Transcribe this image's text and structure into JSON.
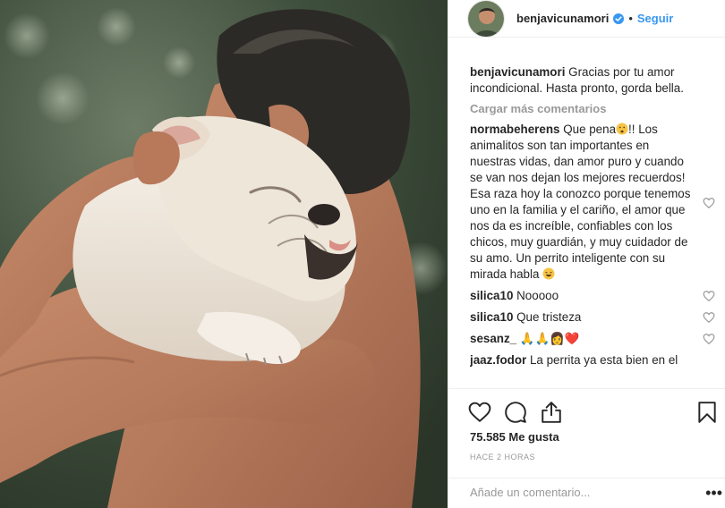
{
  "post": {
    "username": "benjavicunamori",
    "follow_label": "Seguir",
    "dot": "•",
    "caption": {
      "username": "benjavicunamori",
      "text": "Gracias por tu amor incondicional. Hasta pronto, gorda bella."
    },
    "load_more_label": "Cargar más comentarios",
    "comments": [
      {
        "username": "normabeherens",
        "text_before": "Que pena",
        "text_after": "!! Los animalitos son tan importantes en nuestras vidas, dan amor puro y cuando se van nos dejan los mejores recuerdos! Esa raza hoy la conozco porque tenemos uno en la familia y el cariño, el amor que nos da es increíble, confiables con los chicos, muy guardián, y muy cuidador de su amo. Un perrito inteligente con su mirada habla"
      },
      {
        "username": "silica10",
        "text": "Nooooo"
      },
      {
        "username": "silica10",
        "text": "Que tristeza"
      },
      {
        "username": "sesanz_",
        "text": "🙏🙏👩❤️"
      },
      {
        "username": "jaaz.fodor",
        "text": "La perrita ya esta bien en el"
      }
    ],
    "likes_label": "75.585 Me gusta",
    "time_label": "HACE 2 HORAS",
    "comment_placeholder": "Añade un comentario...",
    "more_label": "•••"
  },
  "icons": {
    "like": "heart-outline-icon",
    "comment": "speech-bubble-icon",
    "share": "share-icon",
    "save": "bookmark-icon",
    "verified": "verified-badge-icon"
  },
  "colors": {
    "link_blue": "#3897f0",
    "muted": "#999999",
    "text": "#262626",
    "border": "#efefef",
    "heart_red": "#ed4956"
  }
}
